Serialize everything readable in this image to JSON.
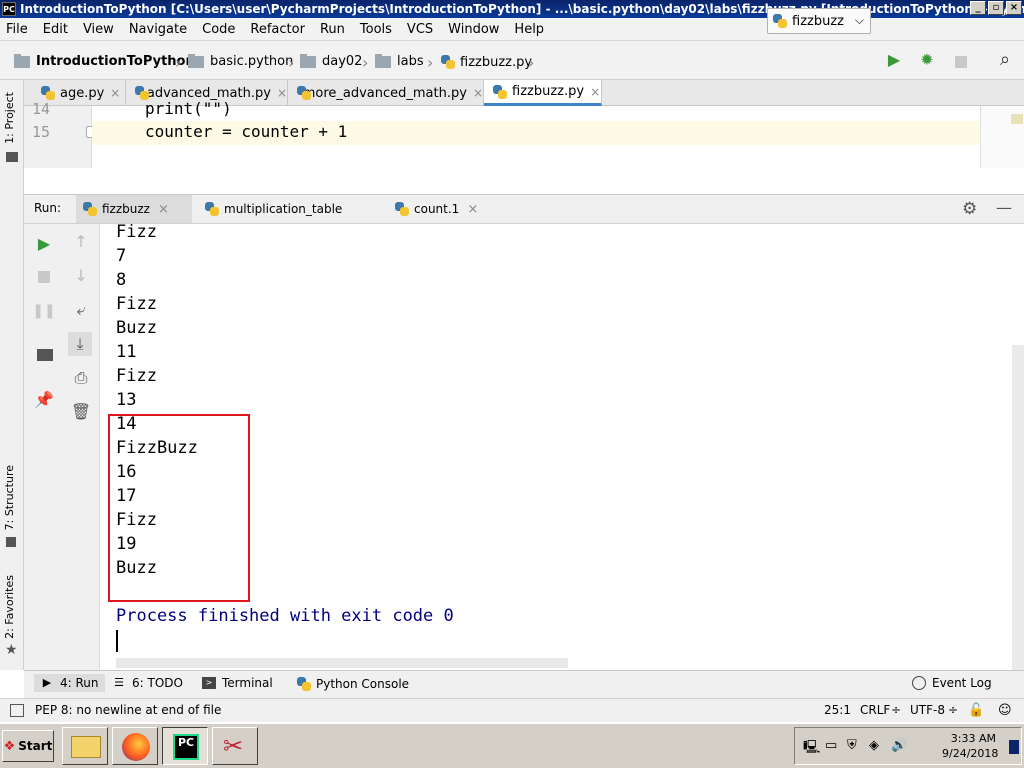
{
  "window": {
    "title": "IntroductionToPython [C:\\Users\\user\\PycharmProjects\\IntroductionToPython] - ...\\basic.python\\day02\\labs\\fizzbuzz.py [IntroductionToPython] - PyCharm",
    "logo": "PC",
    "minimize": "_",
    "maximize": "▫",
    "close": "×"
  },
  "menu": [
    "File",
    "Edit",
    "View",
    "Navigate",
    "Code",
    "Refactor",
    "Run",
    "Tools",
    "VCS",
    "Window",
    "Help"
  ],
  "breadcrumbs": [
    "IntroductionToPython",
    "basic.python",
    "day02",
    "labs",
    "fizzbuzz.py"
  ],
  "run_config": {
    "label": "fizzbuzz"
  },
  "toolbar_icons": [
    "run-icon",
    "debug-icon",
    "stop-icon",
    "search-icon"
  ],
  "editor_tabs": [
    {
      "label": "age.py",
      "active": false
    },
    {
      "label": "advanced_math.py",
      "active": false
    },
    {
      "label": "more_advanced_math.py",
      "active": false
    },
    {
      "label": "fizzbuzz.py",
      "active": true
    }
  ],
  "editor": {
    "lines": [
      {
        "num": "14",
        "code": "print(\"\")"
      },
      {
        "num": "15",
        "code": "counter = counter + 1"
      }
    ]
  },
  "left_strip": {
    "project": "1: Project",
    "structure": "7: Structure",
    "favorites": "2: Favorites"
  },
  "run_panel": {
    "label": "Run:",
    "tabs": [
      {
        "label": "fizzbuzz",
        "active": true
      },
      {
        "label": "multiplication_table",
        "active": false
      },
      {
        "label": "count.1",
        "active": false
      }
    ]
  },
  "console": {
    "output": [
      "Fizz",
      "7",
      "8",
      "Fizz",
      "Buzz",
      "11",
      "Fizz",
      "13",
      "14",
      "FizzBuzz",
      "16",
      "17",
      "Fizz",
      "19",
      "Buzz"
    ],
    "exit_message": "Process finished with exit code 0"
  },
  "bottom_tabs": [
    {
      "label": "4: Run",
      "icon": "run-icon"
    },
    {
      "label": "6: TODO",
      "icon": "todo-icon"
    },
    {
      "label": "Terminal",
      "icon": "terminal-icon"
    },
    {
      "label": "Python Console",
      "icon": "python-console-icon"
    },
    {
      "label": "Event Log",
      "icon": "event-log-icon"
    }
  ],
  "status": {
    "message": "PEP 8: no newline at end of file",
    "position": "25:1",
    "line_sep": "CRLF",
    "encoding": "UTF-8"
  },
  "taskbar": {
    "start": "Start",
    "pycharm_label": "PC",
    "time": "3:33 AM",
    "date": "9/24/2018"
  },
  "colors": {
    "accent": "#4083c9",
    "highlight_box": "#e0141e",
    "exit_text": "#000080",
    "run_green": "#3a9a3a"
  }
}
